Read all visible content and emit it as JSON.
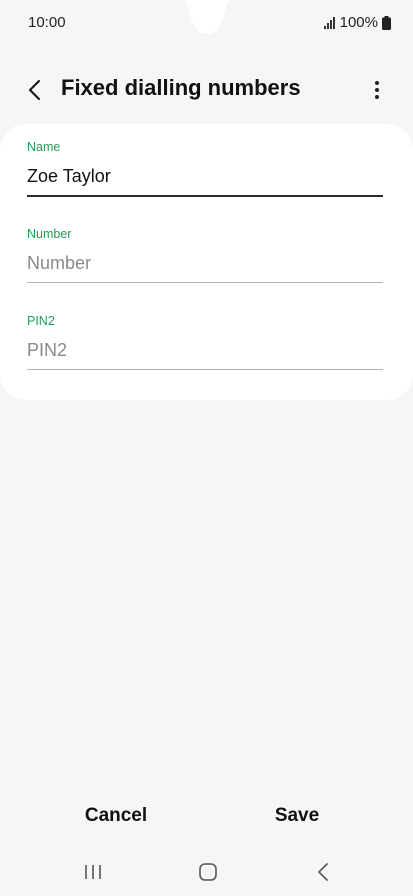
{
  "status": {
    "time": "10:00",
    "battery": "100%"
  },
  "header": {
    "title": "Fixed dialling numbers"
  },
  "form": {
    "name": {
      "label": "Name",
      "value": "Zoe Taylor",
      "placeholder": ""
    },
    "number": {
      "label": "Number",
      "value": "",
      "placeholder": "Number"
    },
    "pin2": {
      "label": "PIN2",
      "value": "",
      "placeholder": "PIN2"
    }
  },
  "actions": {
    "cancel_label": "Cancel",
    "save_label": "Save"
  },
  "colors": {
    "accent": "#1f9d57",
    "background": "#f6f6f8",
    "card": "#ffffff"
  },
  "icons": {
    "back": "chevron-left-icon",
    "more": "more-vertical-icon",
    "signal": "signal-icon",
    "battery": "battery-icon",
    "nav_recents": "recents-icon",
    "nav_home": "home-icon",
    "nav_back": "nav-back-icon"
  }
}
